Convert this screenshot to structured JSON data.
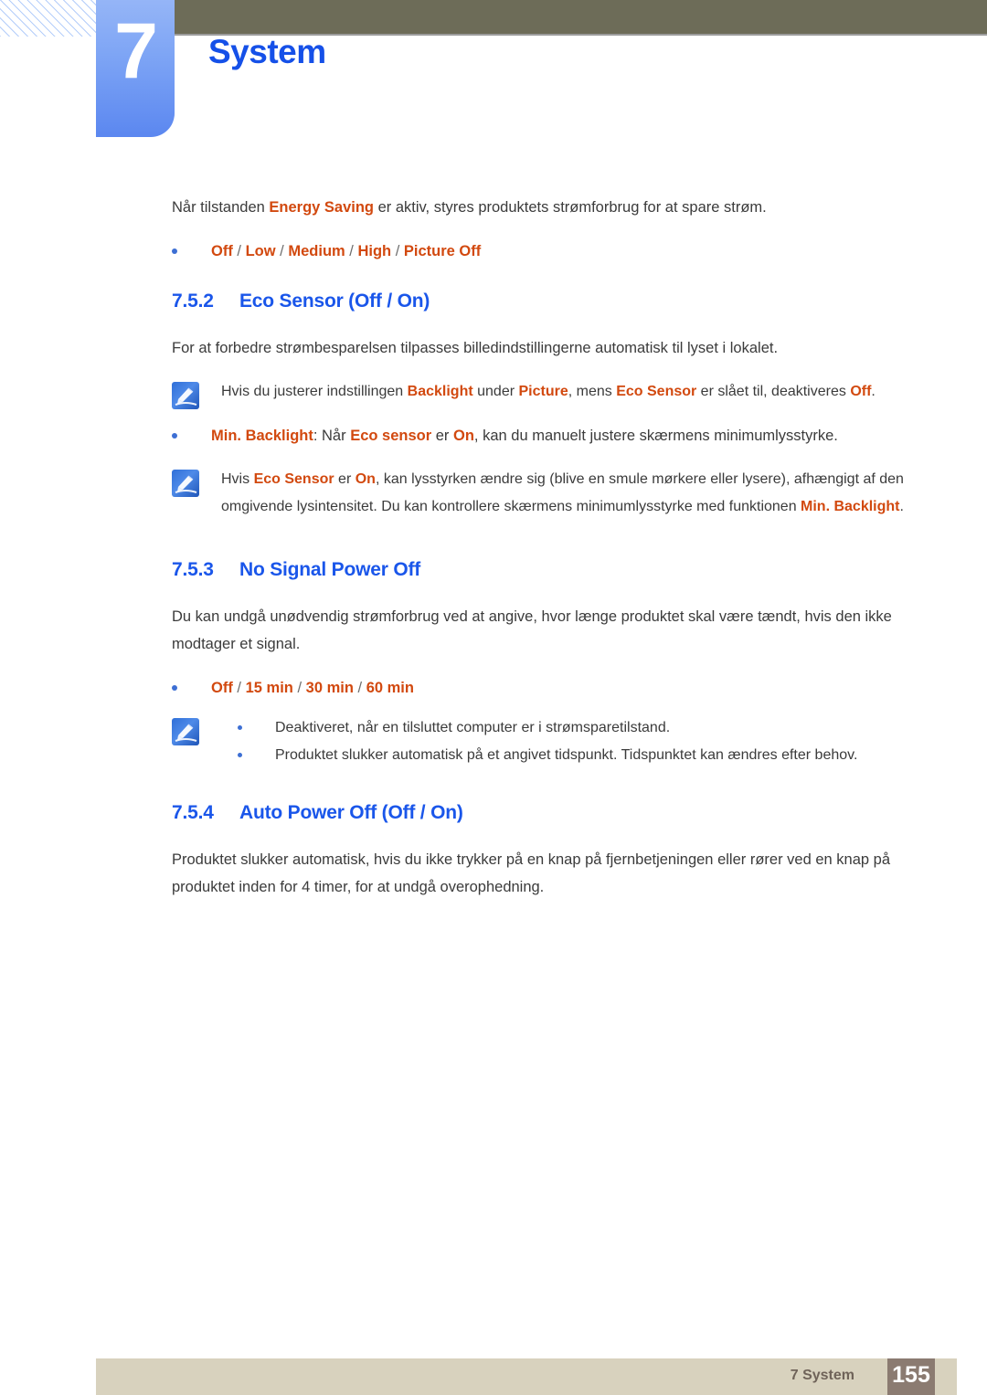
{
  "header": {
    "chapter_number": "7",
    "chapter_title": "System",
    "accent_blue": "#1550e8",
    "olive_bar_color": "#6d6c58",
    "tab_gradient_from": "#95b5f7",
    "tab_gradient_to": "#5b87f0"
  },
  "colors": {
    "highlight_orange": "#d2490f",
    "heading_blue": "#1a56ea",
    "body_gray": "#3b3b3b",
    "bullet_blue": "#3d6fd4",
    "footer_bar": "#d8d2be",
    "footer_page_box": "#8b7b71"
  },
  "intro": {
    "text_before": "Når tilstanden ",
    "highlight": "Energy Saving",
    "text_after": " er aktiv, styres produktets strømforbrug for at spare strøm.",
    "options_bullet": {
      "items": [
        "Off",
        "Low",
        "Medium",
        "High",
        "Picture Off"
      ],
      "separator": " / "
    }
  },
  "sections": [
    {
      "number": "7.5.2",
      "title": "Eco Sensor (Off / On)",
      "intro": "For at forbedre strømbesparelsen tilpasses billedindstillingerne automatisk til lyset i lokalet.",
      "note1": {
        "icon": "note-pencil-icon",
        "p1_a": "Hvis du justerer indstillingen ",
        "p1_b": "Backlight",
        "p1_c": " under ",
        "p1_d": "Picture",
        "p1_e": ", mens ",
        "p1_f": "Eco Sensor",
        "p1_g": " er slået til, deaktiveres ",
        "p1_h": "Off",
        "p1_i": "."
      },
      "bullet": {
        "label": "Min. Backlight",
        "a": ": Når ",
        "b": "Eco sensor",
        "c": " er ",
        "d": "On",
        "e": ", kan du manuelt justere skærmens minimumlysstyrke."
      },
      "note2": {
        "icon": "note-pencil-icon",
        "a": "Hvis ",
        "b": "Eco Sensor",
        "c": " er ",
        "d": "On",
        "e": ", kan lysstyrken ændre sig (blive en smule mørkere eller lysere), afhængigt af den omgivende lysintensitet. Du kan kontrollere skærmens minimumlysstyrke med funktionen ",
        "f": "Min. Backlight",
        "g": "."
      }
    },
    {
      "number": "7.5.3",
      "title": "No Signal Power Off",
      "intro": "Du kan undgå unødvendig strømforbrug ved at angive, hvor længe produktet skal være tændt, hvis den ikke modtager et signal.",
      "options_bullet": {
        "items": [
          "Off",
          "15 min",
          "30 min",
          "60 min"
        ],
        "separator": " / "
      },
      "note": {
        "icon": "note-pencil-icon",
        "items": [
          "Deaktiveret, når en tilsluttet computer er i strømsparetilstand.",
          "Produktet slukker automatisk på et angivet tidspunkt. Tidspunktet kan ændres efter behov."
        ]
      }
    },
    {
      "number": "7.5.4",
      "title": "Auto Power Off (Off / On)",
      "intro": "Produktet slukker automatisk, hvis du ikke trykker på en knap på fjernbetjeningen eller rører ved en knap på produktet inden for 4 timer, for at undgå overophedning."
    }
  ],
  "footer": {
    "label": "7 System",
    "page_number": "155"
  }
}
